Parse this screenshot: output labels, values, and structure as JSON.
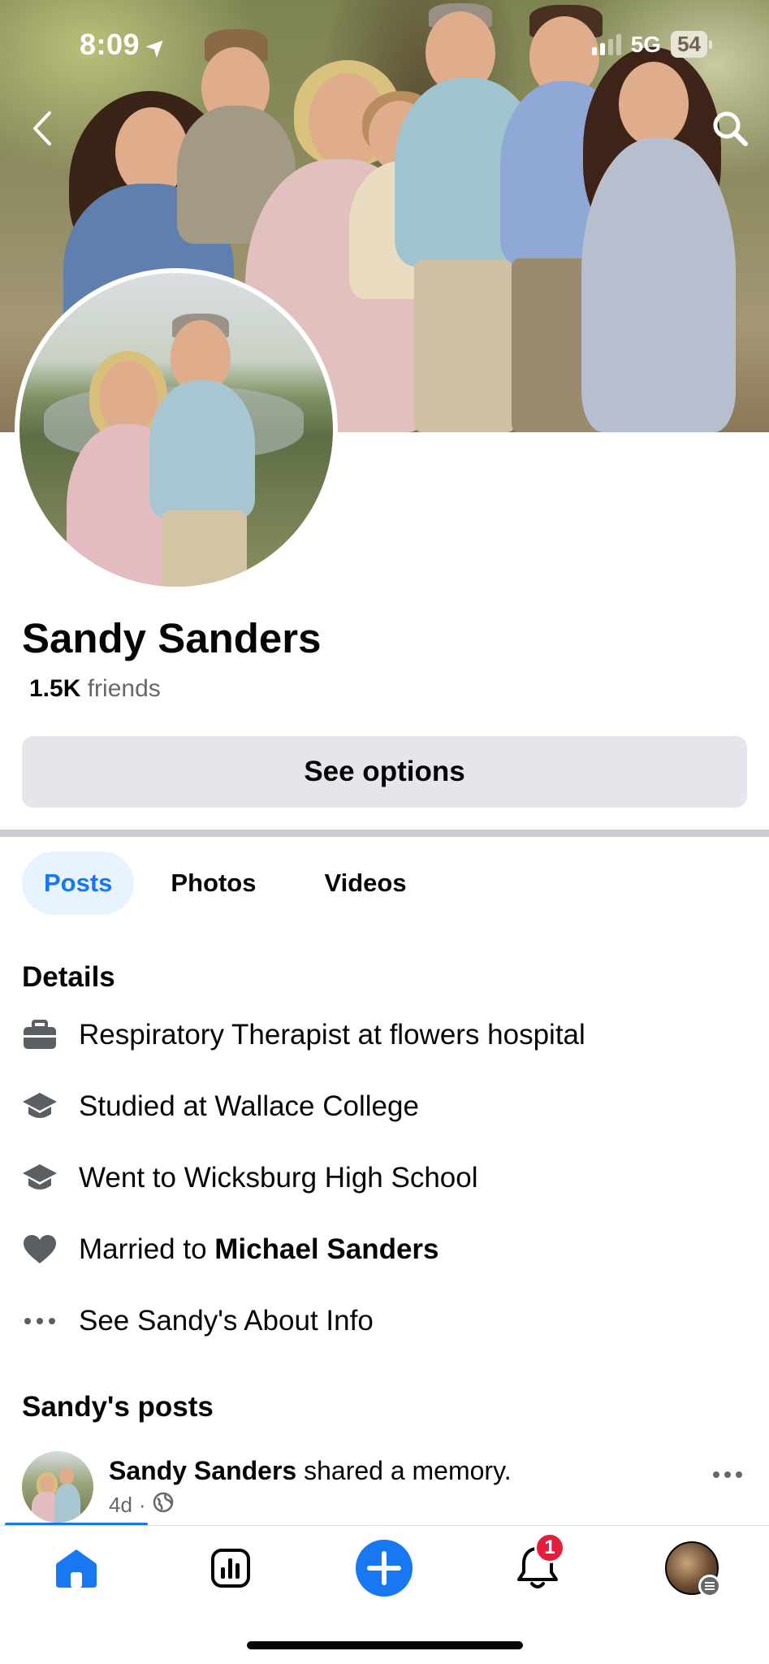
{
  "status_bar": {
    "time": "8:09",
    "network": "5G",
    "battery": "54"
  },
  "profile": {
    "name": "Sandy Sanders",
    "friends_count": "1.5K",
    "friends_label": "friends",
    "options_button": "See options"
  },
  "tabs": [
    {
      "label": "Posts",
      "active": true
    },
    {
      "label": "Photos",
      "active": false
    },
    {
      "label": "Videos",
      "active": false
    }
  ],
  "details": {
    "title": "Details",
    "items": [
      {
        "icon": "briefcase-icon",
        "text": "Respiratory Therapist at flowers hospital"
      },
      {
        "icon": "graduation-cap-icon",
        "text": "Studied at Wallace College"
      },
      {
        "icon": "graduation-cap-icon",
        "text": "Went to Wicksburg High School"
      },
      {
        "icon": "heart-icon",
        "prefix": "Married to ",
        "bold": "Michael Sanders"
      },
      {
        "icon": "more-dots-icon",
        "text": "See Sandy's About Info"
      }
    ]
  },
  "posts_section": {
    "title": "Sandy's posts",
    "first_post": {
      "author": "Sandy Sanders",
      "action": " shared a memory.",
      "time": "4d",
      "separator": "·",
      "privacy_icon": "globe-icon"
    }
  },
  "bottom_nav": {
    "items": [
      "home-icon",
      "dashboard-icon",
      "create-icon",
      "notifications-icon",
      "profile-menu-icon"
    ],
    "notifications_badge": "1"
  },
  "colors": {
    "accent": "#1877f2",
    "tab_active_bg": "#e7f3ff",
    "button_bg": "#e4e6eb",
    "secondary_text": "#65676b",
    "badge": "#e41e3f"
  }
}
